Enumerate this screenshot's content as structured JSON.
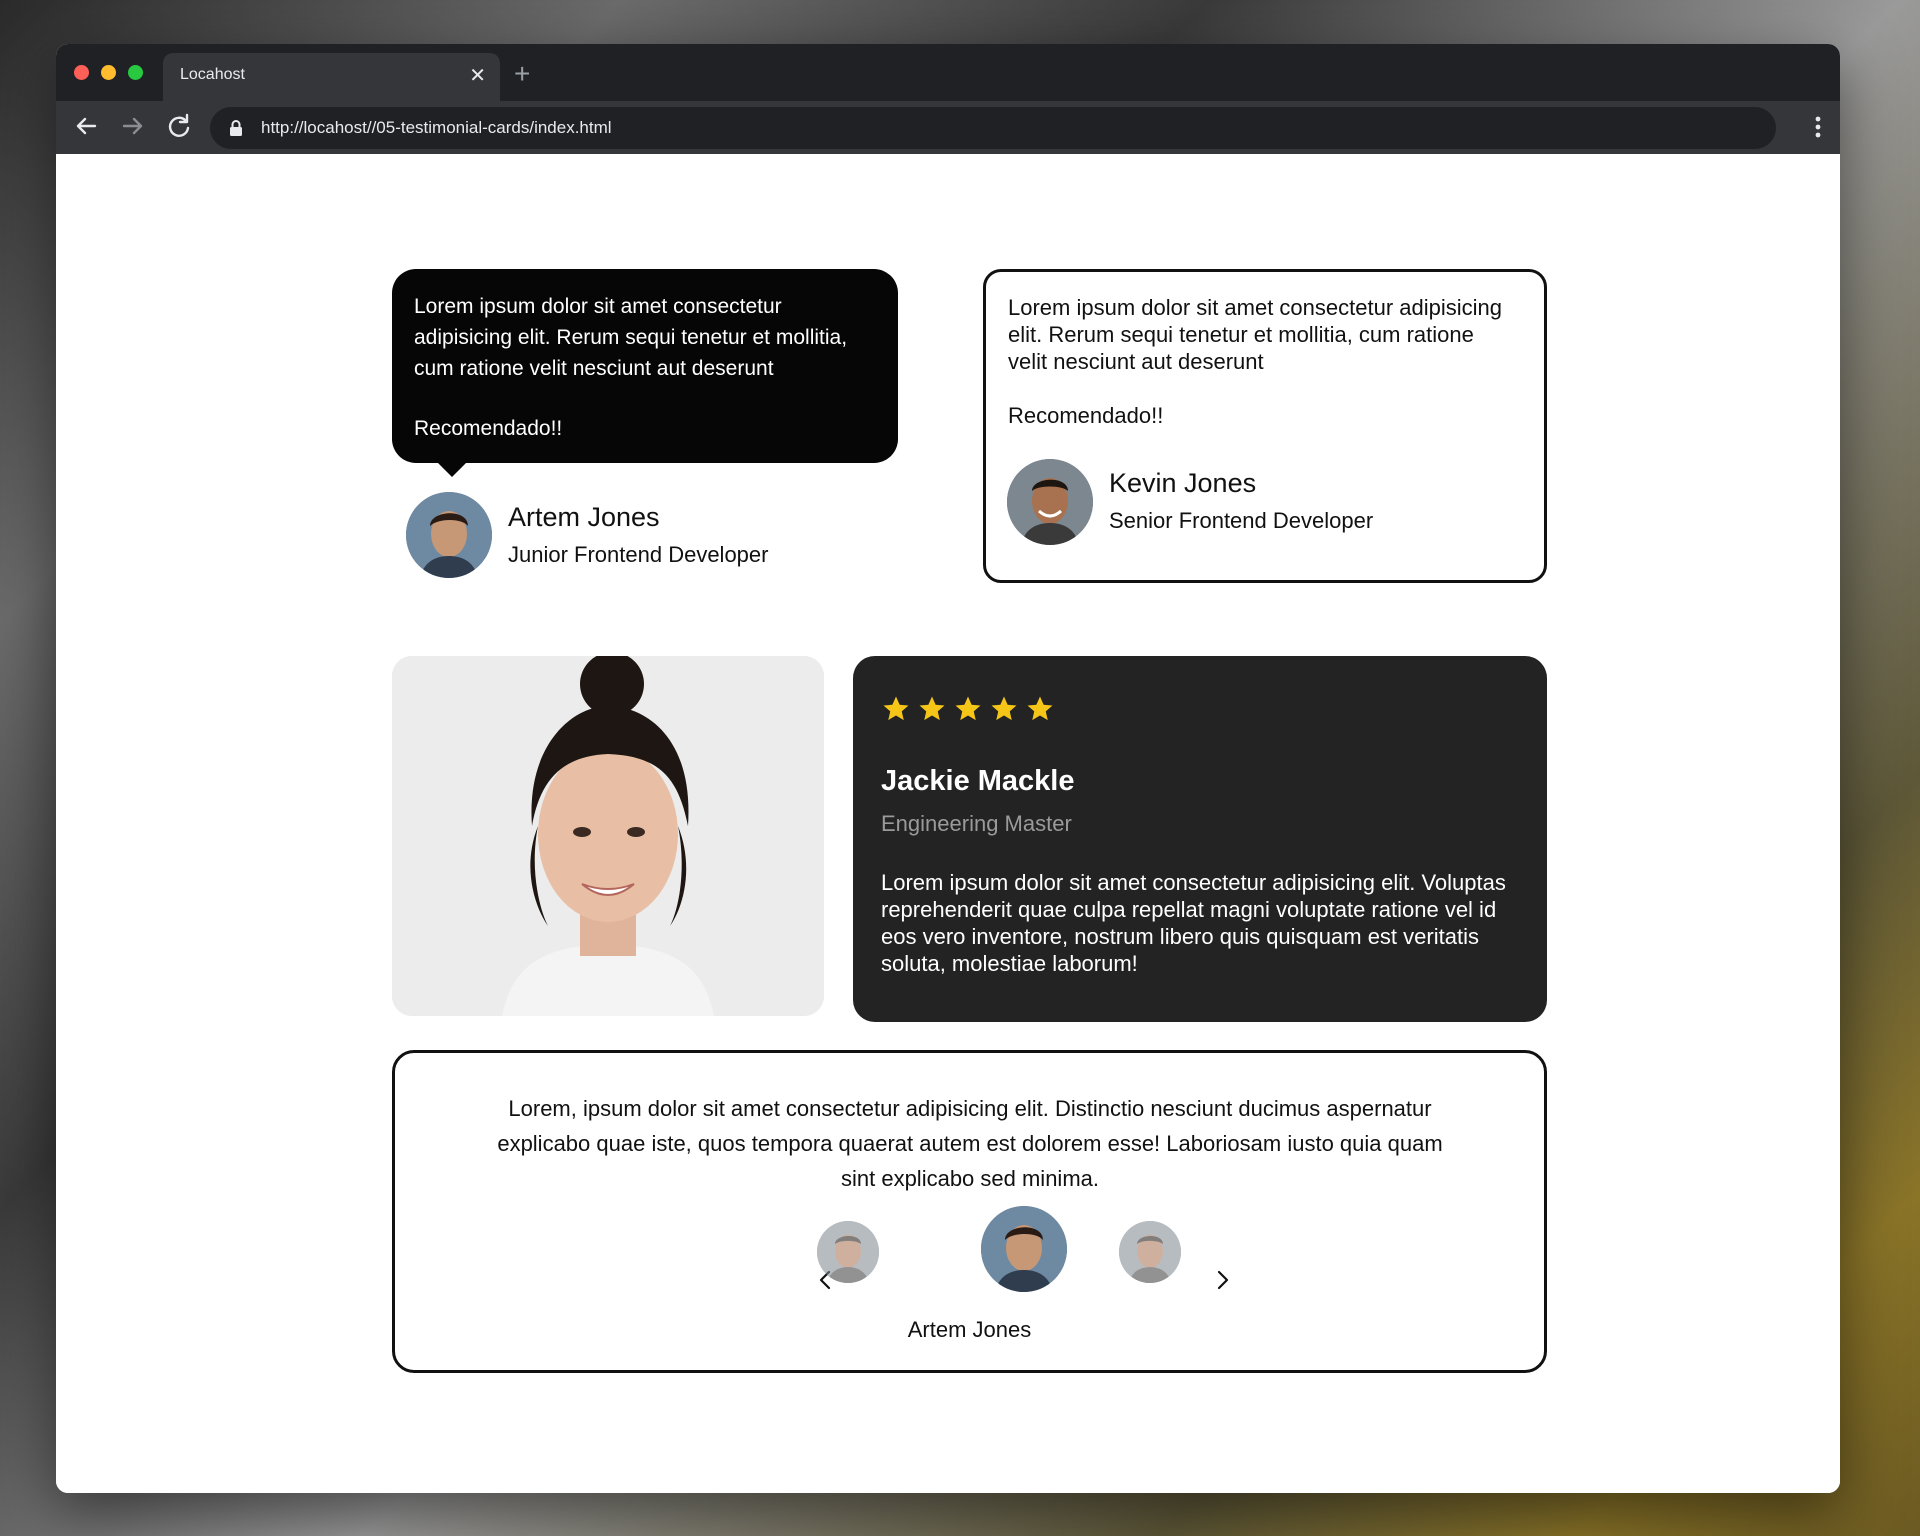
{
  "browser": {
    "tab_title": "Locahost",
    "close_glyph": "✕",
    "new_tab_glyph": "+",
    "url": "http://locahost//05-testimonial-cards/index.html"
  },
  "card1": {
    "text": "Lorem ipsum dolor sit amet consectetur adipisicing elit. Rerum sequi tenetur et mollitia, cum ratione velit nesciunt aut deserunt",
    "recommend": "Recomendado!!",
    "name": "Artem Jones",
    "role": "Junior Frontend Developer"
  },
  "card2": {
    "text": "Lorem ipsum dolor sit amet consectetur adipisicing elit. Rerum sequi tenetur et mollitia, cum ratione velit nesciunt aut deserunt",
    "recommend": "Recomendado!!",
    "name": "Kevin Jones",
    "role": "Senior Frontend Developer"
  },
  "card4": {
    "rating": 5,
    "star_color": "#f5c518",
    "name": "Jackie Mackle",
    "role": "Engineering Master",
    "text": "Lorem ipsum dolor sit amet consectetur adipisicing elit. Voluptas reprehenderit quae culpa repellat magni voluptate ratione vel id eos vero inventore, nostrum libero quis quisquam est veritatis soluta, molestiae laborum!"
  },
  "card5": {
    "text": "Lorem, ipsum dolor sit amet consectetur adipisicing elit. Distinctio nesciunt ducimus aspernatur explicabo quae iste, quos tempora quaerat autem est dolorem esse! Laboriosam iusto quia quam sint explicabo sed minima.",
    "active_name": "Artem Jones"
  }
}
